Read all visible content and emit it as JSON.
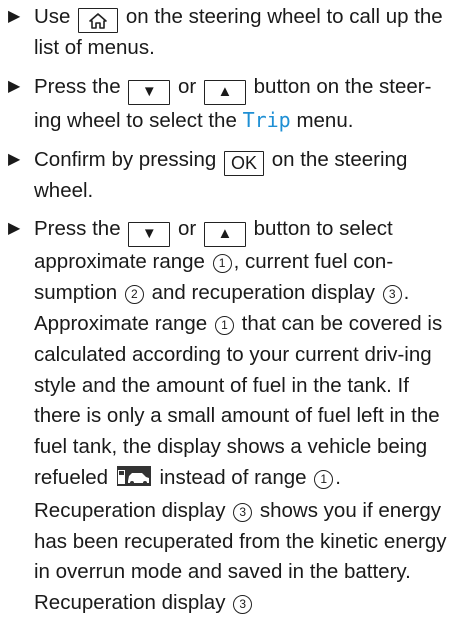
{
  "steps": [
    {
      "pre": "Use",
      "post": "on the steering wheel to call up the list of menus."
    },
    {
      "pre": "Press the",
      "or": "or",
      "post": "button on the steer-ing wheel to select the",
      "menu": "Trip",
      "post2": "menu."
    },
    {
      "pre": "Confirm by pressing",
      "ok": "OK",
      "post": "on the steering wheel."
    },
    {
      "pre": "Press the",
      "or": "or",
      "post": "button to select approximate range",
      "t2": ", current fuel con-sumption",
      "t3": "and recuperation display",
      "t4": ".",
      "t5": "Approximate range",
      "t6": "that can be covered is calculated according to your current driv-ing style and the amount of fuel in the tank. If there is only a small amount of fuel left in the fuel tank, the display shows a vehicle being refueled",
      "t7": "instead of range",
      "t8": "."
    }
  ],
  "continuation": {
    "a": "Recuperation display",
    "b": "shows you if energy has been recuperated from the kinetic energy in overrun mode and saved in the battery. Recuperation display"
  },
  "markers": {
    "one": "1",
    "two": "2",
    "three": "3"
  },
  "colors": {
    "menu_name": "#1e8fd4"
  },
  "icons": [
    "home-icon",
    "down-arrow-icon",
    "up-arrow-icon",
    "refuel-vehicle-icon"
  ]
}
